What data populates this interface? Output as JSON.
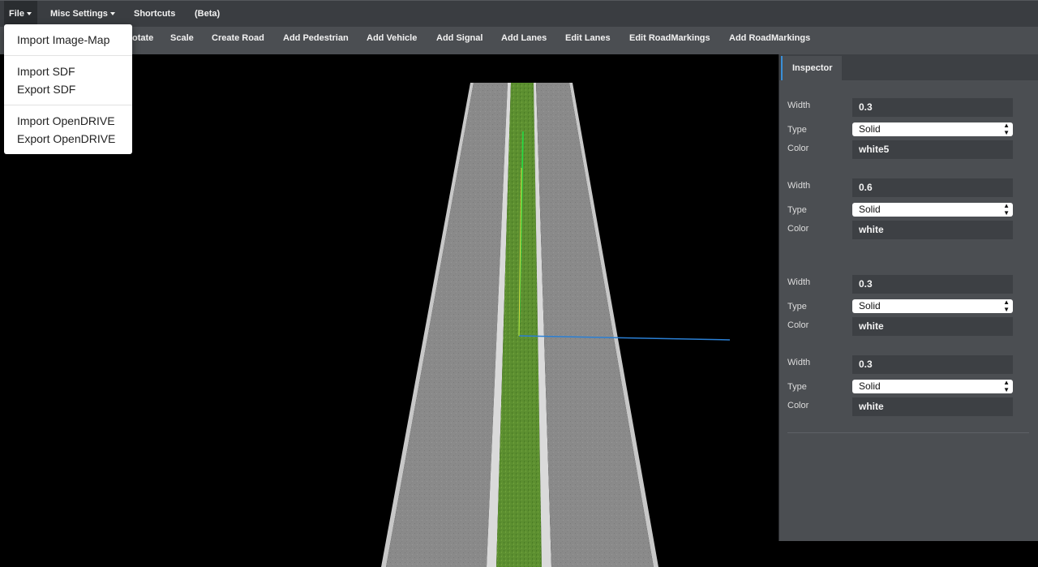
{
  "menubar": {
    "file": "File",
    "misc_settings": "Misc Settings",
    "shortcuts": "Shortcuts",
    "beta": "(Beta)"
  },
  "toolbar": {
    "rotate": "otate",
    "scale": "Scale",
    "create_road": "Create Road",
    "add_pedestrian": "Add Pedestrian",
    "add_vehicle": "Add Vehicle",
    "add_signal": "Add Signal",
    "add_lanes": "Add Lanes",
    "edit_lanes": "Edit Lanes",
    "edit_roadmarkings": "Edit RoadMarkings",
    "add_roadmarkings": "Add RoadMarkings"
  },
  "file_menu": {
    "import_image_map": "Import Image-Map",
    "import_sdf": "Import SDF",
    "export_sdf": "Export SDF",
    "import_opendrive": "Import OpenDRIVE",
    "export_opendrive": "Export OpenDRIVE"
  },
  "inspector": {
    "tab": "Inspector",
    "markings": [
      {
        "width_label": "Width",
        "width": "0.3",
        "type_label": "Type",
        "type": "Solid",
        "color_label": "Color",
        "color": "white5"
      },
      {
        "width_label": "Width",
        "width": "0.6",
        "type_label": "Type",
        "type": "Solid",
        "color_label": "Color",
        "color": "white"
      },
      {
        "width_label": "Width",
        "width": "0.3",
        "type_label": "Type",
        "type": "Solid",
        "color_label": "Color",
        "color": "white"
      },
      {
        "width_label": "Width",
        "width": "0.3",
        "type_label": "Type",
        "type": "Solid",
        "color_label": "Color",
        "color": "white"
      }
    ]
  },
  "colors": {
    "menubar_bg": "#3a3d41",
    "toolbar_bg": "#4b4e52",
    "inspector_bg": "#4b4e52",
    "road_asphalt": "#8a8a8a",
    "median_grass": "#5c8f30",
    "axis_y": "#22dd44",
    "axis_x": "#2a7fd4",
    "tab_accent": "#3a8fd8"
  },
  "icons": {
    "dropdown_caret": "caret-down-icon",
    "select_arrows": "updown-arrows-icon"
  }
}
